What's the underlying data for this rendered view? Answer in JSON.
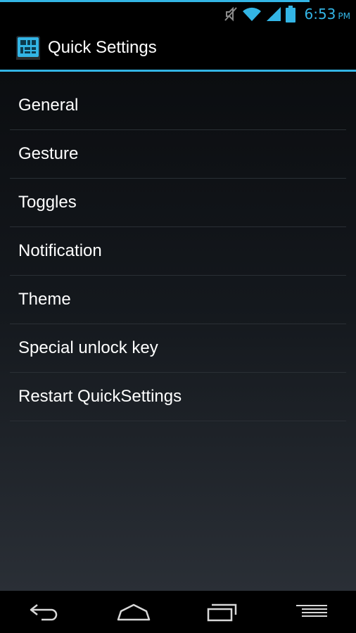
{
  "status_bar": {
    "time": "6:53",
    "ampm": "PM",
    "icons": [
      "mute-icon",
      "wifi-icon",
      "signal-icon",
      "battery-icon"
    ],
    "accent_color": "#33b5e5"
  },
  "action_bar": {
    "title": "Quick Settings",
    "icon": "app-grid-icon"
  },
  "menu": {
    "items": [
      {
        "label": "General"
      },
      {
        "label": "Gesture"
      },
      {
        "label": "Toggles"
      },
      {
        "label": "Notification"
      },
      {
        "label": "Theme"
      },
      {
        "label": "Special unlock key"
      },
      {
        "label": "Restart QuickSettings"
      }
    ]
  },
  "nav_bar": {
    "buttons": [
      "back-icon",
      "home-icon",
      "recent-apps-icon",
      "menu-icon"
    ]
  }
}
